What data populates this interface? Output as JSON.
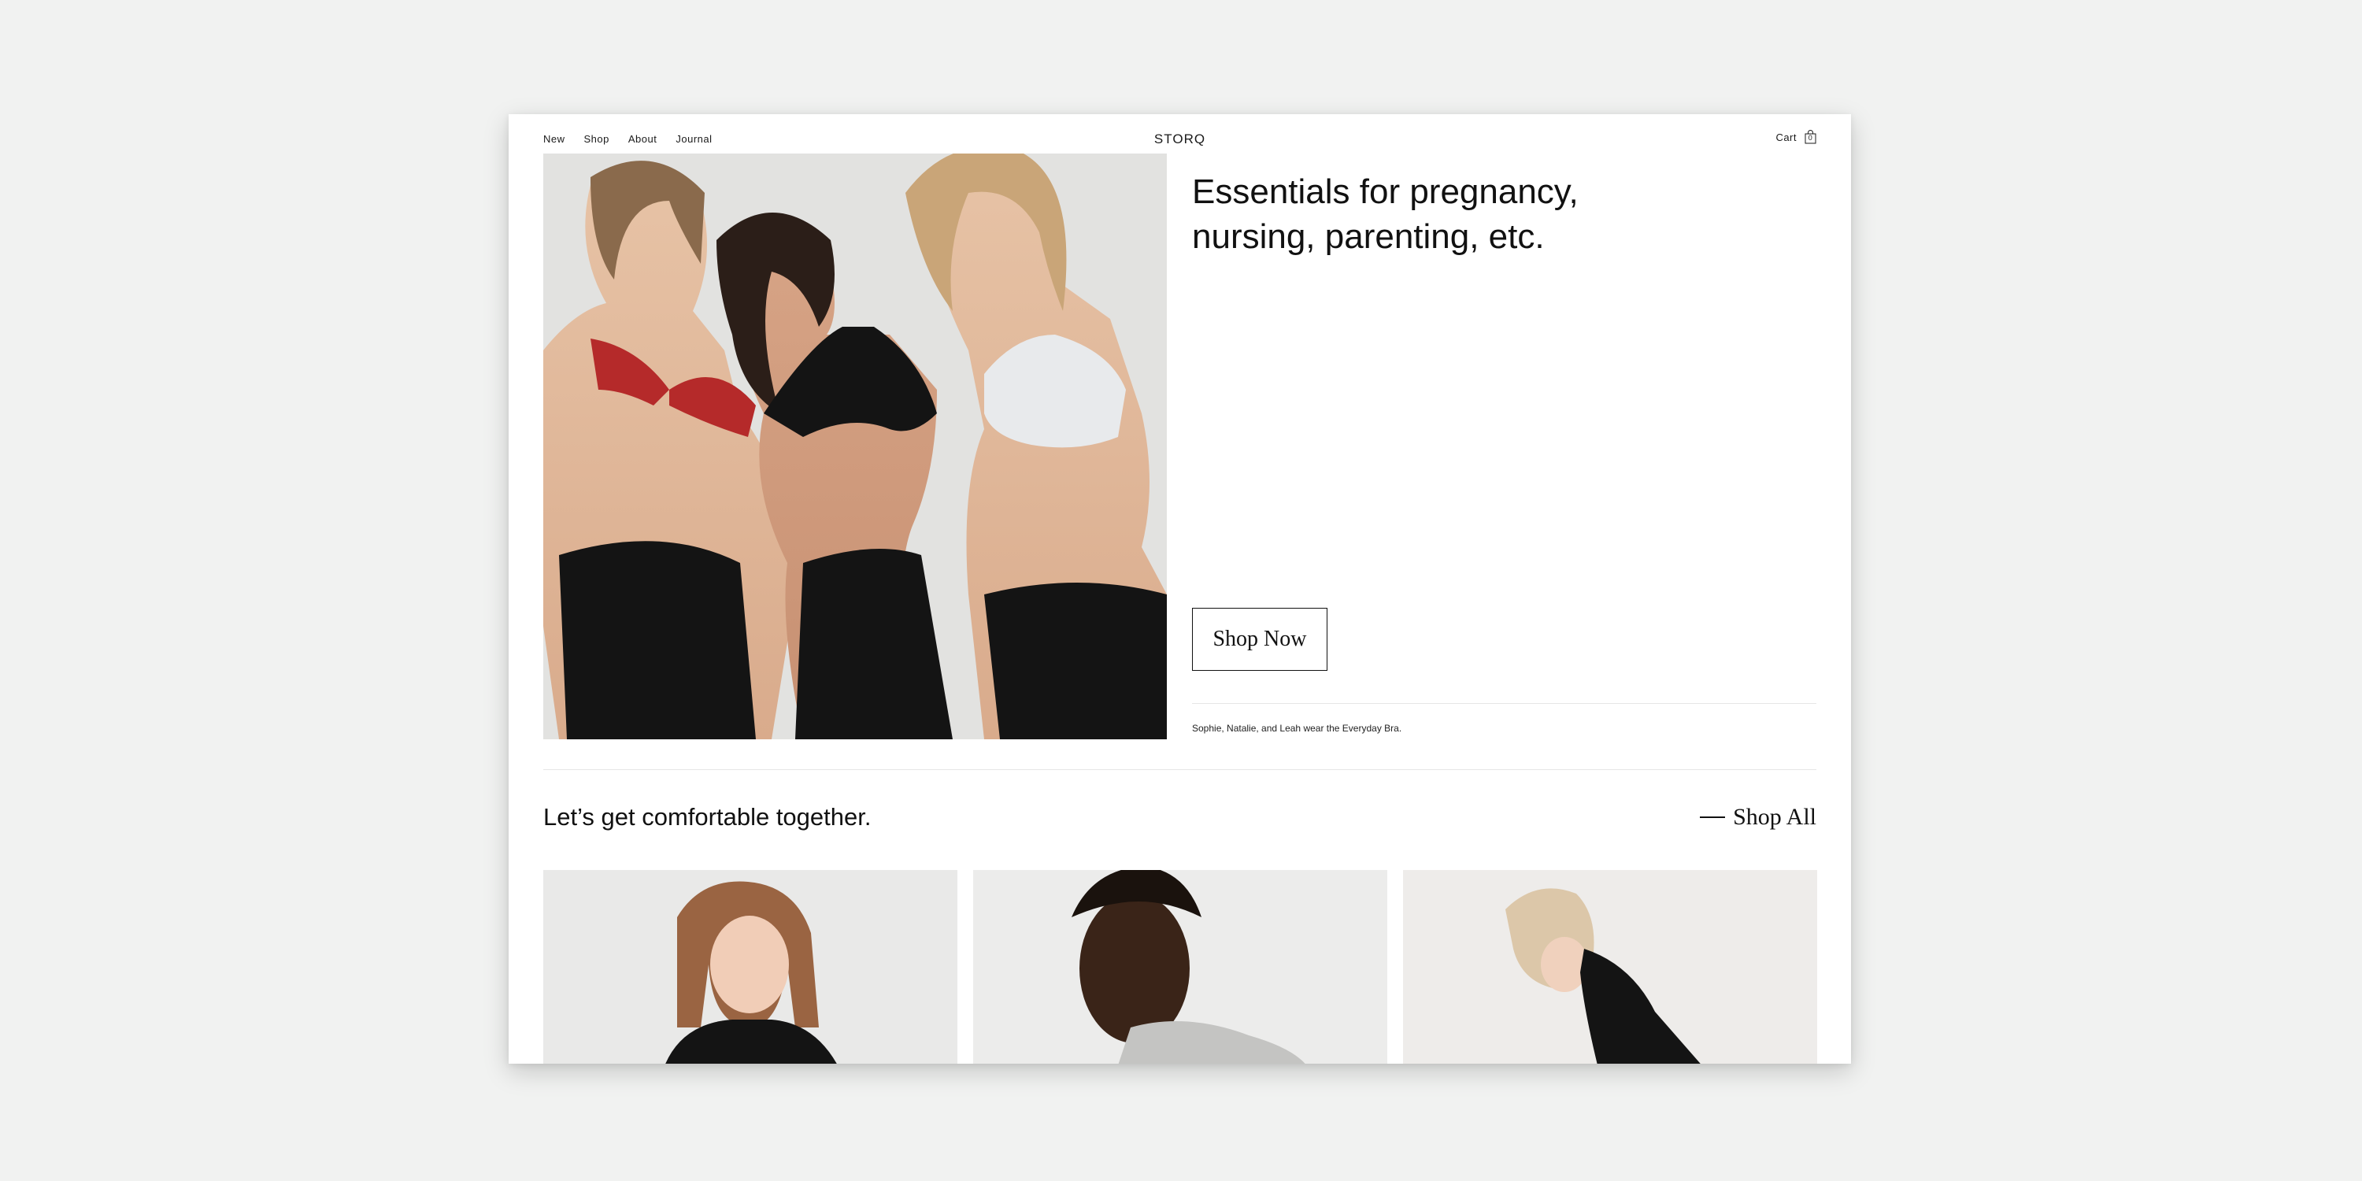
{
  "nav": {
    "items": [
      "New",
      "Shop",
      "About",
      "Journal"
    ],
    "logo": "STORQ",
    "cart_label": "Cart",
    "cart_count": "0"
  },
  "hero": {
    "title": "Essentials for pregnancy, nursing, parenting, etc.",
    "cta_label": "Shop Now",
    "caption": "Sophie, Natalie, and Leah wear the Everyday Bra."
  },
  "section": {
    "title": "Let’s get comfortable together.",
    "shop_all_label": "Shop All"
  },
  "products": [
    {
      "image": "woman-black-top-photo"
    },
    {
      "image": "woman-grey-top-smiling-photo"
    },
    {
      "image": "woman-black-dress-leaning-photo"
    }
  ],
  "colors": {
    "backdrop": "#f1f2f1",
    "page": "#ffffff",
    "text": "#1a1a1a",
    "bra_red": "#b52a2a",
    "fabric_black": "#141414",
    "bra_white": "#e8eaec"
  }
}
